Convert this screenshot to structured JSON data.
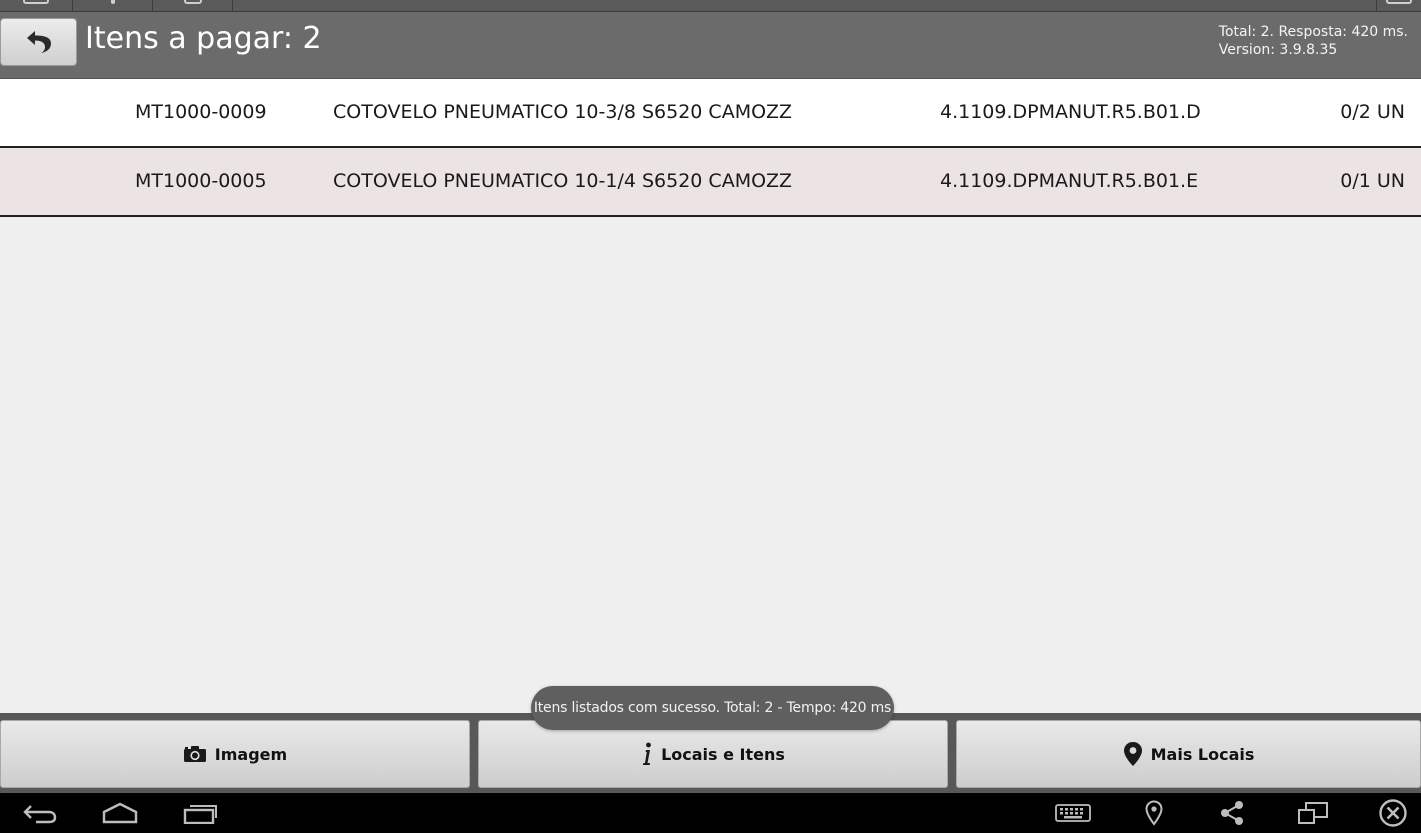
{
  "header": {
    "title": "Itens a pagar: 2",
    "total_line": "Total: 2. Resposta: 420 ms.",
    "version_line": "Version: 3.9.8.35"
  },
  "items": [
    {
      "code": "MT1000-0009",
      "description": "COTOVELO PNEUMATICO 10-3/8 S6520 CAMOZZ",
      "location": "4.1109.DPMANUT.R5.B01.D",
      "quantity": "0/2 UN"
    },
    {
      "code": "MT1000-0005",
      "description": "COTOVELO PNEUMATICO 10-1/4 S6520 CAMOZZ",
      "location": "4.1109.DPMANUT.R5.B01.E",
      "quantity": "0/1 UN"
    }
  ],
  "toast": {
    "message": "Itens listados com sucesso. Total: 2 - Tempo: 420 ms"
  },
  "actions": {
    "image": {
      "label": "Imagem",
      "icon": "camera-icon"
    },
    "info": {
      "label": "Locais e Itens",
      "icon": "info-icon"
    },
    "more": {
      "label": "Mais Locais",
      "icon": "map-pin-icon"
    }
  },
  "system_nav": {
    "icons": [
      "back-icon",
      "home-icon",
      "recent-apps-icon",
      "keyboard-icon",
      "location-icon",
      "share-icon",
      "screen-icon",
      "close-circle-icon"
    ]
  },
  "colors": {
    "header_bg": "#6b6b6b",
    "row_alt_bg": "#ece4e4",
    "toast_bg": "#5f5f5f",
    "nav_bg": "#000000"
  }
}
